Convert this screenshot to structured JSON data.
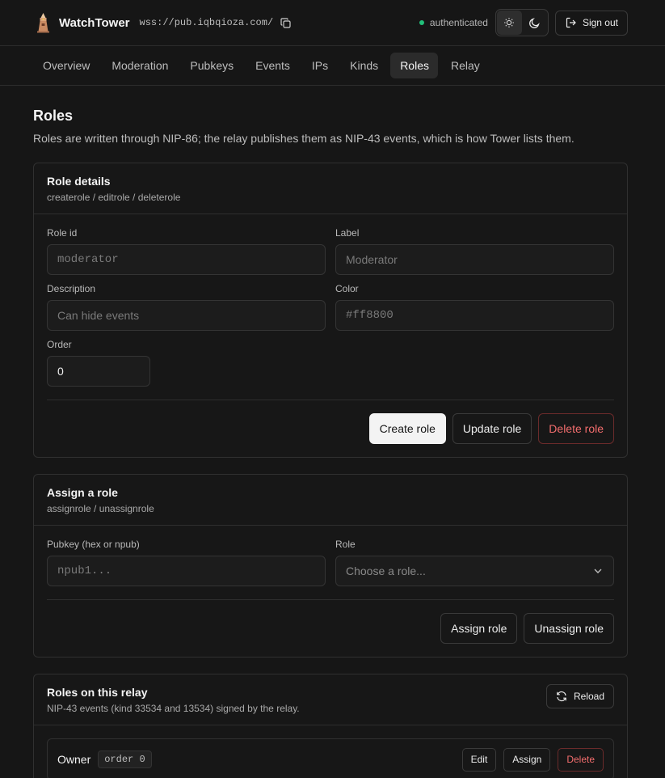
{
  "header": {
    "app_name": "WatchTower",
    "relay_url": "wss://pub.iqbqioza.com/",
    "auth_status": "authenticated",
    "status_color": "#22c07a",
    "sign_out_label": "Sign out",
    "theme": "dark"
  },
  "nav": {
    "tabs": [
      {
        "label": "Overview"
      },
      {
        "label": "Moderation"
      },
      {
        "label": "Pubkeys"
      },
      {
        "label": "Events"
      },
      {
        "label": "IPs"
      },
      {
        "label": "Kinds"
      },
      {
        "label": "Roles",
        "active": true
      },
      {
        "label": "Relay"
      }
    ]
  },
  "page": {
    "title": "Roles",
    "description": "Roles are written through NIP-86; the relay publishes them as NIP-43 events, which is how Tower lists them."
  },
  "role_details": {
    "title": "Role details",
    "subtitle": "createrole / editrole / deleterole",
    "role_id_label": "Role id",
    "role_id_placeholder": "moderator",
    "label_label": "Label",
    "label_placeholder": "Moderator",
    "description_label": "Description",
    "description_placeholder": "Can hide events",
    "color_label": "Color",
    "color_placeholder": "#ff8800",
    "order_label": "Order",
    "order_value": "0",
    "create_label": "Create role",
    "update_label": "Update role",
    "delete_label": "Delete role"
  },
  "assign_role": {
    "title": "Assign a role",
    "subtitle": "assignrole / unassignrole",
    "pubkey_label": "Pubkey (hex or npub)",
    "pubkey_placeholder": "npub1...",
    "role_label": "Role",
    "role_placeholder": "Choose a role...",
    "assign_label": "Assign role",
    "unassign_label": "Unassign role"
  },
  "roles_list": {
    "title": "Roles on this relay",
    "subtitle": "NIP-43 events (kind 33534 and 13534) signed by the relay.",
    "reload_label": "Reload",
    "roles": [
      {
        "name": "Owner",
        "order_badge": "order 0",
        "edit_label": "Edit",
        "assign_label": "Assign",
        "delete_label": "Delete"
      }
    ]
  }
}
